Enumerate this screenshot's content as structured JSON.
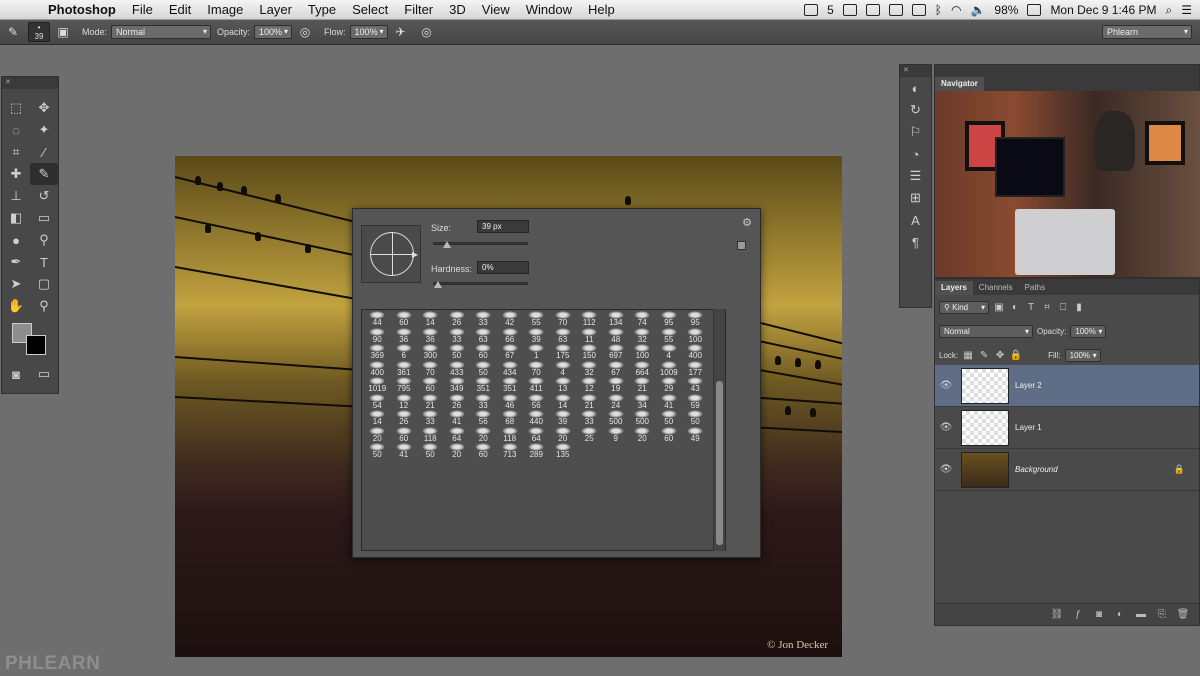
{
  "menubar": {
    "apple_icon": "apple-icon",
    "items": [
      "Photoshop",
      "File",
      "Edit",
      "Image",
      "Layer",
      "Type",
      "Select",
      "Filter",
      "3D",
      "View",
      "Window",
      "Help"
    ],
    "status": {
      "badge": "5",
      "battery": "98%",
      "datetime": "Mon Dec 9  1:46 PM"
    }
  },
  "options": {
    "brush_size": "39",
    "mode_label": "Mode:",
    "mode_value": "Normal",
    "opacity_label": "Opacity:",
    "opacity_value": "100%",
    "flow_label": "Flow:",
    "flow_value": "100%",
    "workspace": "Phlearn"
  },
  "picker": {
    "size_label": "Size:",
    "size_value": "39 px",
    "size_fraction": 0.1,
    "hardness_label": "Hardness:",
    "hardness_value": "0%",
    "hardness_fraction": 0.0,
    "brushes": [
      "44",
      "60",
      "14",
      "26",
      "33",
      "42",
      "55",
      "70",
      "112",
      "134",
      "74",
      "95",
      "95",
      "90",
      "36",
      "36",
      "33",
      "63",
      "66",
      "39",
      "63",
      "11",
      "48",
      "32",
      "55",
      "100",
      "369",
      "6",
      "300",
      "50",
      "60",
      "67",
      "1",
      "175",
      "150",
      "697",
      "100",
      "4",
      "400",
      "400",
      "361",
      "70",
      "433",
      "50",
      "434",
      "70",
      "4",
      "32",
      "67",
      "664",
      "1009",
      "177",
      "1019",
      "795",
      "60",
      "349",
      "351",
      "351",
      "411",
      "13",
      "12",
      "19",
      "21",
      "29",
      "43",
      "54",
      "12",
      "21",
      "26",
      "33",
      "46",
      "56",
      "14",
      "21",
      "24",
      "34",
      "41",
      "59",
      "14",
      "26",
      "33",
      "41",
      "56",
      "68",
      "440",
      "39",
      "33",
      "500",
      "500",
      "50",
      "50",
      "20",
      "60",
      "118",
      "64",
      "20",
      "118",
      "64",
      "20",
      "25",
      "9",
      "20",
      "60",
      "49",
      "50",
      "41",
      "50",
      "20",
      "60",
      "713",
      "289",
      "135"
    ]
  },
  "canvas": {
    "watermark": "© Jon Decker"
  },
  "navigator": {
    "tab": "Navigator"
  },
  "layers": {
    "tabs": [
      "Layers",
      "Channels",
      "Paths"
    ],
    "filter_kind": "Kind",
    "blend_mode": "Normal",
    "opacity_label": "Opacity:",
    "opacity_value": "100%",
    "lock_label": "Lock:",
    "fill_label": "Fill:",
    "fill_value": "100%",
    "items": [
      {
        "name": "Layer 2",
        "selected": true
      },
      {
        "name": "Layer 1",
        "selected": false
      },
      {
        "name": "Background",
        "selected": false
      }
    ]
  },
  "logo": {
    "text": "PHLEARN"
  }
}
